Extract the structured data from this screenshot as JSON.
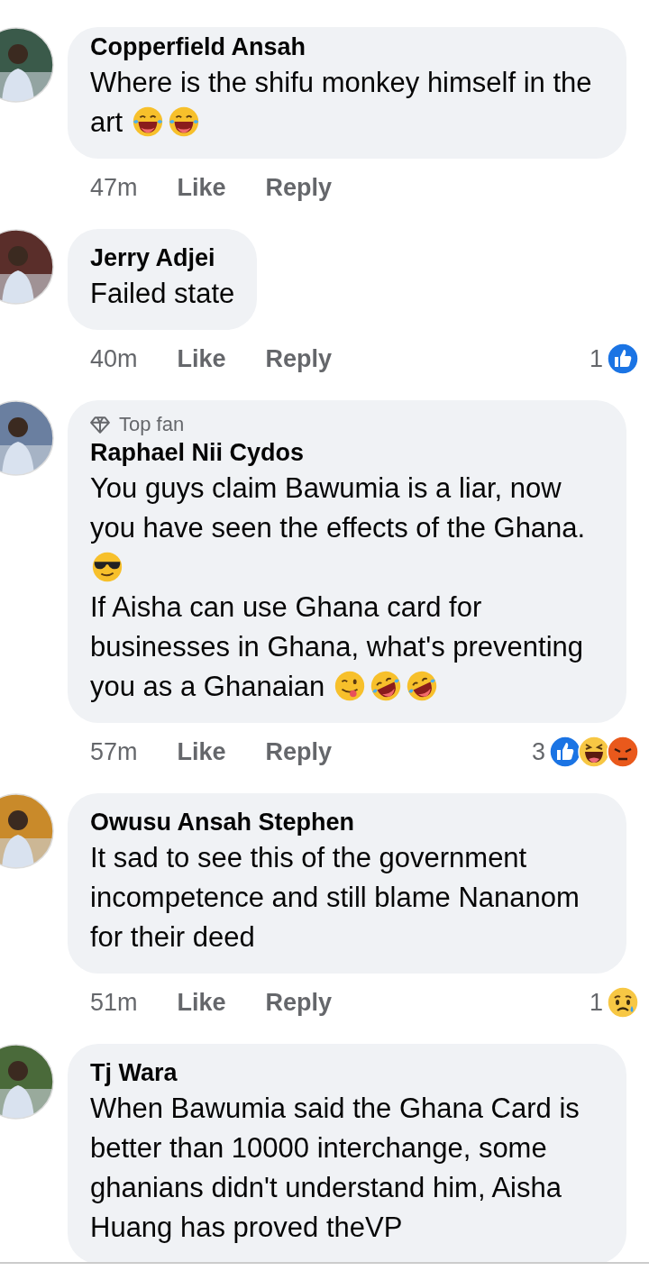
{
  "comments": [
    {
      "name": "Copperfield Ansah",
      "paragraphs": [
        [
          {
            "kind": "text",
            "text": "Where is the shifu monkey himself in the art "
          },
          {
            "kind": "tears-of-joy"
          },
          {
            "kind": "tears-of-joy"
          }
        ]
      ],
      "time": "47m",
      "like": "Like",
      "reply": "Reply"
    },
    {
      "name": "Jerry Adjei",
      "paragraphs": [
        [
          {
            "kind": "text",
            "text": "Failed state"
          }
        ]
      ],
      "time": "40m",
      "like": "Like",
      "reply": "Reply",
      "reaction_count": "1",
      "reactions": [
        {
          "kind": "like"
        }
      ]
    },
    {
      "name": "Raphael Nii Cydos",
      "badge": "Top fan",
      "paragraphs": [
        [
          {
            "kind": "text",
            "text": "You guys claim Bawumia is a liar, now you have seen the effects of the Ghana. "
          },
          {
            "kind": "sunglasses"
          }
        ],
        [
          {
            "kind": "text",
            "text": "If Aisha can use Ghana card for businesses in Ghana, what's preventing you as a Ghanaian "
          },
          {
            "kind": "tongue"
          },
          {
            "kind": "rolling-laugh"
          },
          {
            "kind": "rolling-laugh"
          }
        ]
      ],
      "time": "57m",
      "like": "Like",
      "reply": "Reply",
      "reaction_count": "3",
      "reactions": [
        {
          "kind": "like"
        },
        {
          "kind": "haha"
        },
        {
          "kind": "angry"
        }
      ]
    },
    {
      "name": "Owusu Ansah Stephen",
      "paragraphs": [
        [
          {
            "kind": "text",
            "text": "It sad to see this of the government incompetence and still blame Nananom for their deed"
          }
        ]
      ],
      "time": "51m",
      "like": "Like",
      "reply": "Reply",
      "reaction_count": "1",
      "reactions": [
        {
          "kind": "sad"
        }
      ]
    },
    {
      "name": "Tj Wara",
      "paragraphs": [
        [
          {
            "kind": "text",
            "text": "When Bawumia said the Ghana Card is better than 10000 interchange, some ghanians didn't understand him, Aisha Huang has proved theVP"
          }
        ]
      ]
    }
  ]
}
